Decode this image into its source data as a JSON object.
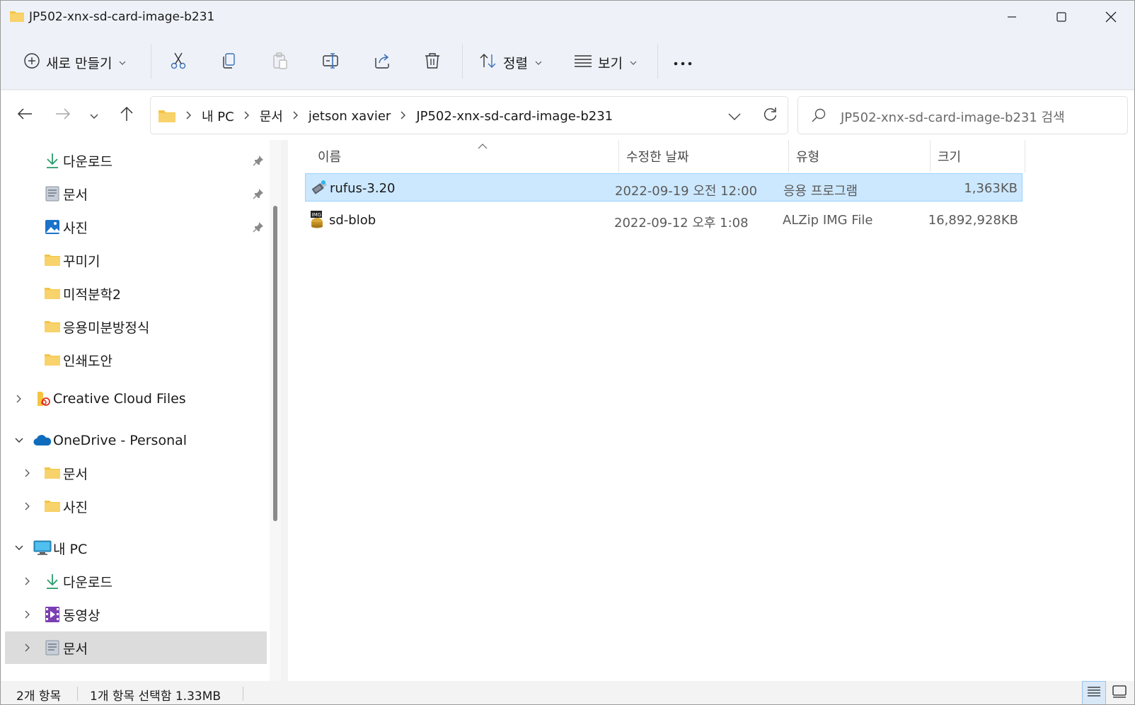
{
  "window": {
    "title": "JP502-xnx-sd-card-image-b231"
  },
  "toolbar": {
    "new_label": "새로 만들기",
    "sort_label": "정렬",
    "view_label": "보기",
    "more_label": "···"
  },
  "address": {
    "crumbs": [
      "내 PC",
      "문서",
      "jetson xavier",
      "JP502-xnx-sd-card-image-b231"
    ],
    "crumb_separator": ">"
  },
  "search": {
    "placeholder": "JP502-xnx-sd-card-image-b231 검색"
  },
  "sidebar": {
    "quick_access": [
      {
        "label": "다운로드",
        "icon": "download-icon",
        "pinned": true
      },
      {
        "label": "문서",
        "icon": "document-icon",
        "pinned": true
      },
      {
        "label": "사진",
        "icon": "pictures-icon",
        "pinned": true
      },
      {
        "label": "꾸미기",
        "icon": "folder-icon",
        "pinned": false
      },
      {
        "label": "미적분학2",
        "icon": "folder-icon",
        "pinned": false
      },
      {
        "label": "응용미분방정식",
        "icon": "folder-icon",
        "pinned": false
      },
      {
        "label": "인쇄도안",
        "icon": "folder-icon",
        "pinned": false
      }
    ],
    "creative_cloud": {
      "label": "Creative Cloud Files",
      "icon": "creative-cloud-icon"
    },
    "onedrive": {
      "label": "OneDrive - Personal",
      "icon": "onedrive-icon",
      "children": [
        {
          "label": "문서",
          "icon": "folder-icon"
        },
        {
          "label": "사진",
          "icon": "folder-icon"
        }
      ]
    },
    "this_pc": {
      "label": "내 PC",
      "icon": "computer-icon",
      "children": [
        {
          "label": "다운로드",
          "icon": "download-icon"
        },
        {
          "label": "동영상",
          "icon": "video-icon"
        },
        {
          "label": "문서",
          "icon": "document-icon",
          "selected": true
        }
      ]
    }
  },
  "columns": {
    "name": "이름",
    "date": "수정한 날짜",
    "type": "유형",
    "size": "크기"
  },
  "files": [
    {
      "name": "rufus-3.20",
      "date": "2022-09-19 오전 12:00",
      "type": "응용 프로그램",
      "size": "1,363KB",
      "icon": "usb-drive-icon",
      "selected": true
    },
    {
      "name": "sd-blob",
      "date": "2022-09-12 오후 1:08",
      "type": "ALZip IMG File",
      "size": "16,892,928KB",
      "icon": "disk-image-icon",
      "selected": false
    }
  ],
  "status": {
    "count": "2개 항목",
    "selection": "1개 항목 선택함 1.33MB"
  },
  "colors": {
    "selection_bg": "#cce8ff",
    "selection_border": "#99d1ff",
    "folder_yellow": "#f5c443",
    "accent": "#0067c0"
  }
}
